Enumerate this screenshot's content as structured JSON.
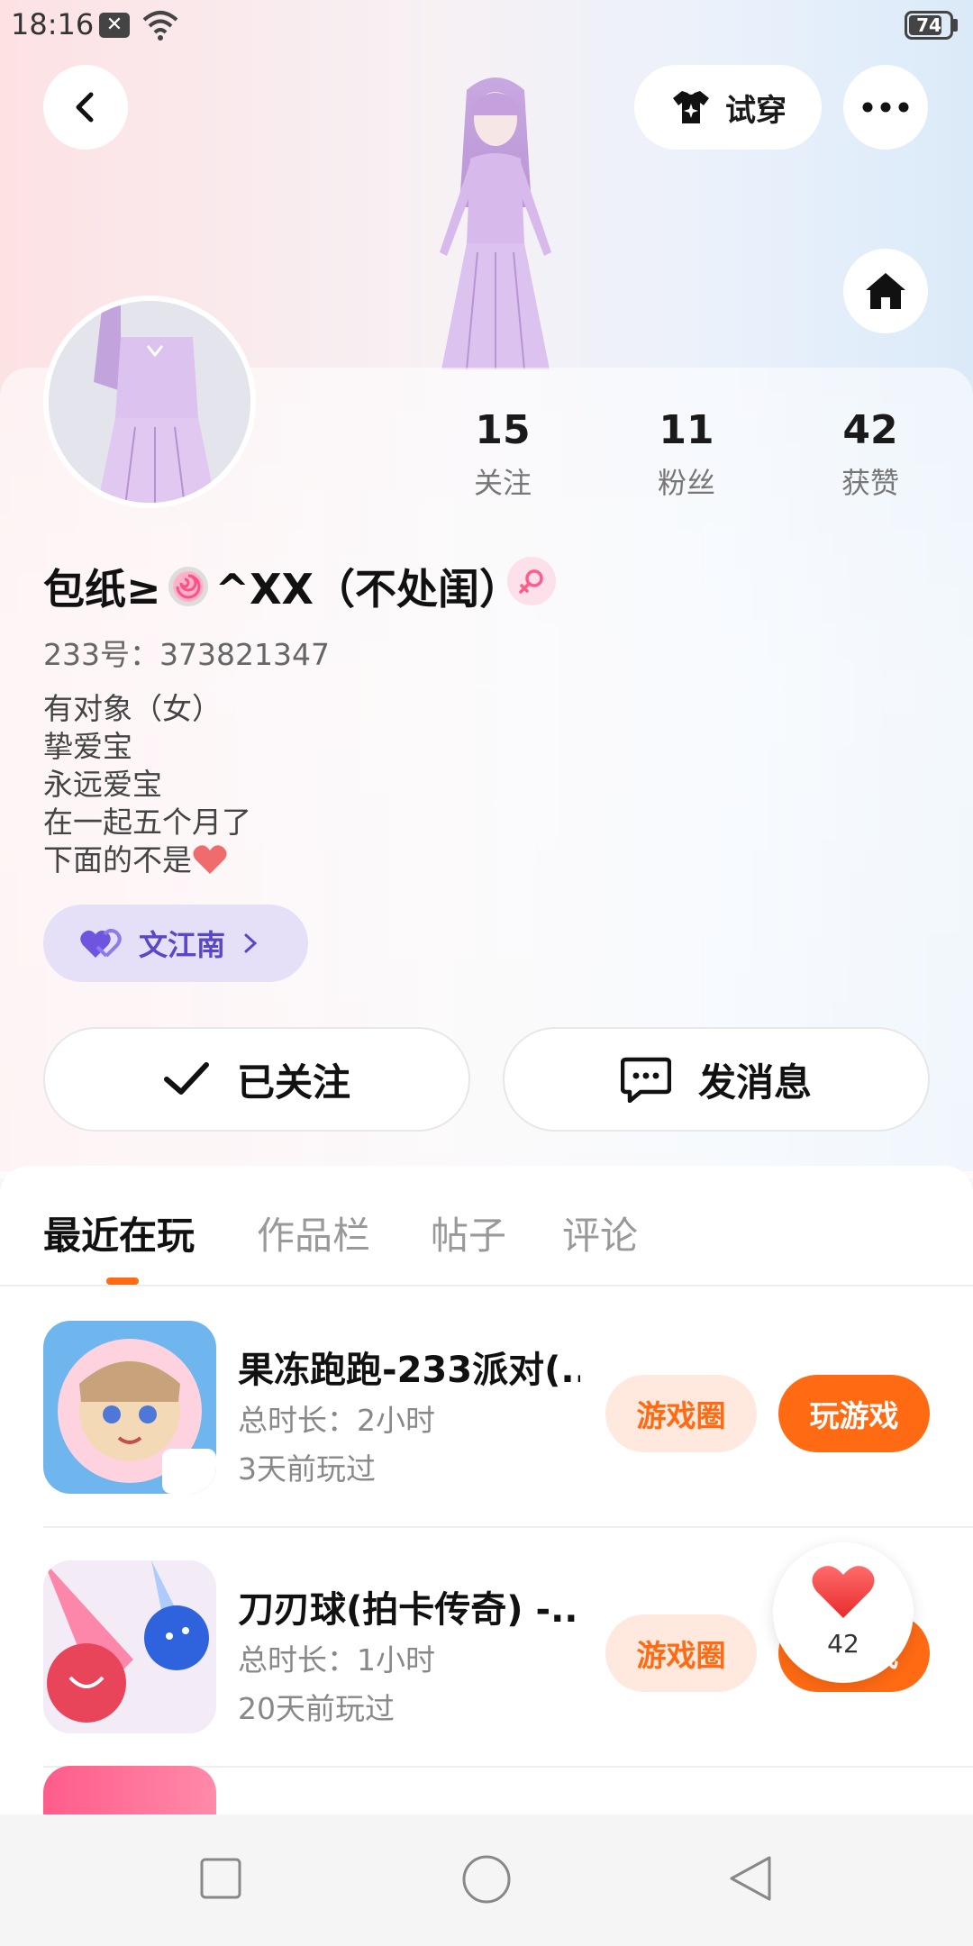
{
  "status_bar": {
    "time": "18:16",
    "battery": "74",
    "notif_icon": "x-icon"
  },
  "header": {
    "try_on_label": "试穿"
  },
  "stats": [
    {
      "value": "15",
      "label": "关注"
    },
    {
      "value": "11",
      "label": "粉丝"
    },
    {
      "value": "42",
      "label": "获赞"
    }
  ],
  "profile": {
    "name_prefix": "包纸≥",
    "name_suffix": "^XX（不处闺）",
    "uid": "233号：373821347",
    "bio": [
      "有对象（女）",
      "挚爱宝",
      "永远爱宝",
      "在一起五个月了",
      "下面的不是"
    ],
    "cp_name": "文江南",
    "gender_color": "#ff5c8a"
  },
  "actions": {
    "followed_label": "已关注",
    "message_label": "发消息"
  },
  "tabs": [
    "最近在玩",
    "作品栏",
    "帖子",
    "评论"
  ],
  "games": [
    {
      "title": "果冻跑跑-233派对(...",
      "duration": "总时长：2小时",
      "last_played": "3天前玩过",
      "circle_label": "游戏圈",
      "play_label": "玩游戏"
    },
    {
      "title": "刀刃球(拍卡传奇) -...",
      "duration": "总时长：1小时",
      "last_played": "20天前玩过",
      "circle_label": "游戏圈",
      "play_label": "玩游戏"
    }
  ],
  "like_fab": {
    "count": "42"
  },
  "colors": {
    "accent": "#ff6a13",
    "accent_light": "#ffe9df",
    "cp_bg": "#e5e0f7",
    "cp_text": "#5a46c9"
  }
}
